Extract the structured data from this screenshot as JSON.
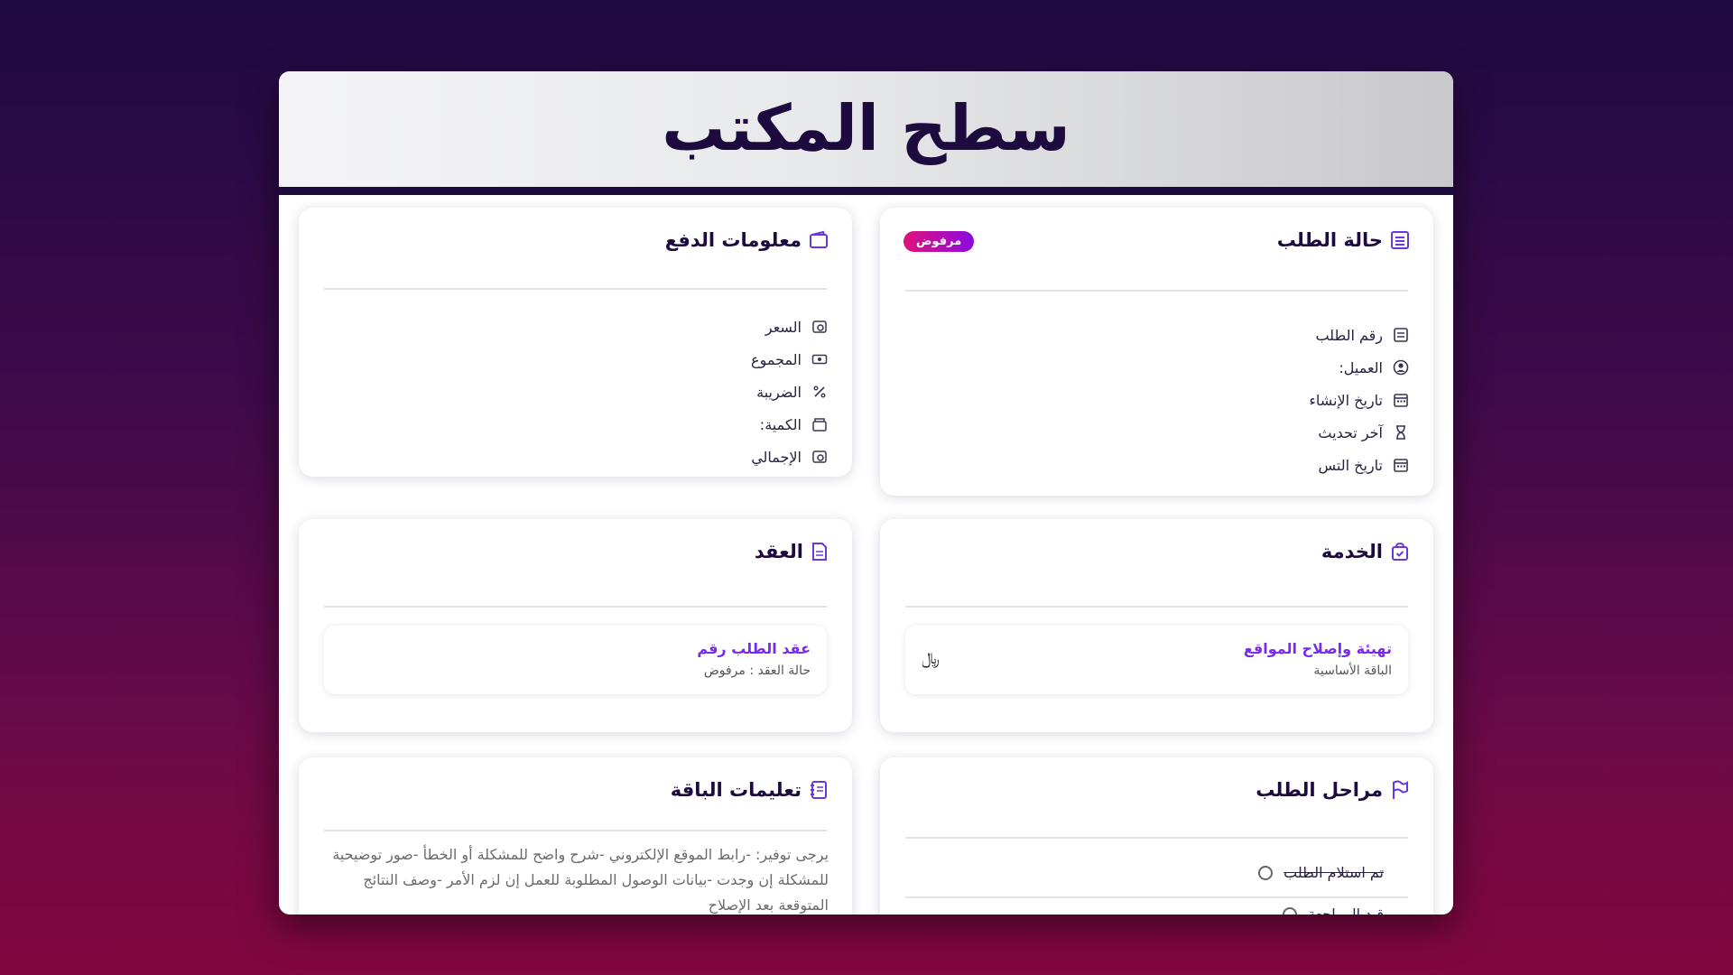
{
  "header": {
    "title": "سطح المكتب"
  },
  "order_status": {
    "title": "حالة الطلب",
    "badge": "مرفوض",
    "rows": [
      {
        "icon": "list-icon",
        "label": "رقم الطلب"
      },
      {
        "icon": "user-circle-icon",
        "label": "العميل:"
      },
      {
        "icon": "calendar-icon",
        "label": "تاريخ الإنشاء"
      },
      {
        "icon": "hourglass-icon",
        "label": "آخر تحديث"
      },
      {
        "icon": "calendar-icon",
        "label": "تاريخ التس"
      }
    ]
  },
  "payment": {
    "title": "معلومات الدفع",
    "rows": [
      {
        "icon": "money-icon",
        "label": "السعر"
      },
      {
        "icon": "cash-icon",
        "label": "المجموع"
      },
      {
        "icon": "percent-icon",
        "label": "الضريبة"
      },
      {
        "icon": "box-icon",
        "label": "الكمية:"
      },
      {
        "icon": "money-icon",
        "label": "الإجمالي"
      }
    ]
  },
  "service": {
    "title": "الخدمة",
    "item_name": "تهيئة وإصلاح المواقع",
    "item_package": "الباقة الأساسية",
    "price": "﷼"
  },
  "contract": {
    "title": "العقد",
    "item_name": "عقد الطلب رقم",
    "item_status": "حالة العقد : مرفوض"
  },
  "stages": {
    "title": "مراحل الطلب",
    "items": [
      "تم استلام الطلب",
      "قيد المراجعة"
    ]
  },
  "package_instructions": {
    "title": "تعليمات الباقة",
    "text": "يرجى توفير: -رابط الموقع الإلكتروني -شرح واضح للمشكلة أو الخطأ -صور توضيحية للمشكلة إن وجدت -بيانات الوصول المطلوبة للعمل إن لزم الأمر -وصف النتائج المتوقعة بعد الإصلاح"
  },
  "colors": {
    "accent": "#6b35e0",
    "header_text": "#1d0b3f",
    "badge_start": "#e0127b",
    "badge_end": "#8a0ae0"
  }
}
